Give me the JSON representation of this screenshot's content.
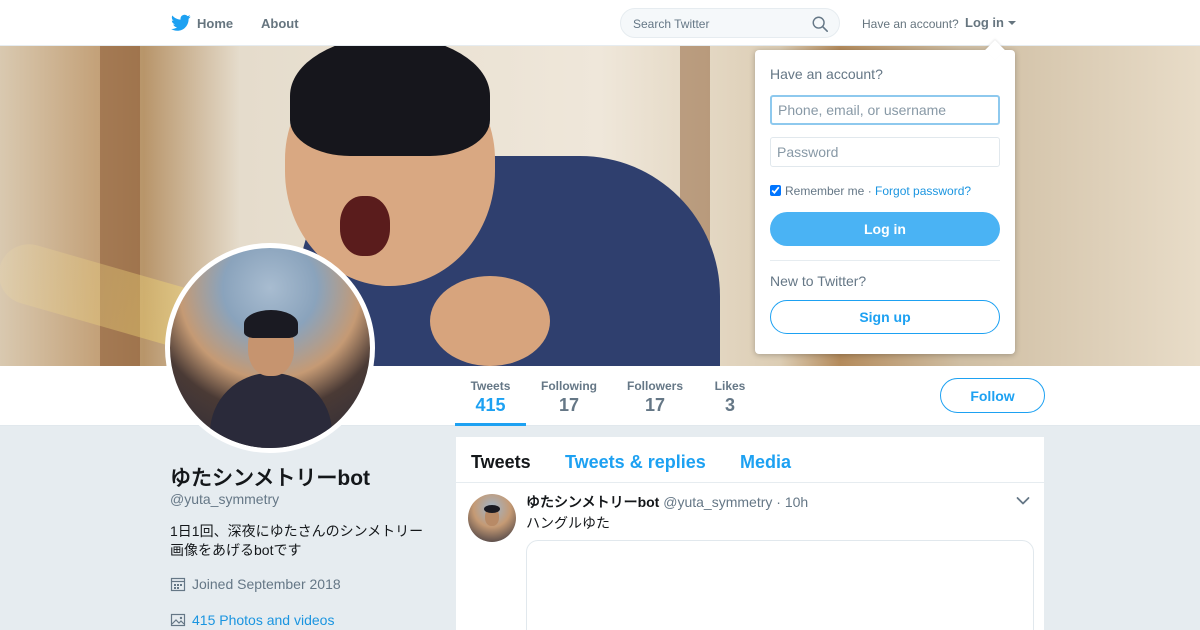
{
  "nav": {
    "logo_icon": "twitter-bird-icon",
    "home_label": "Home",
    "about_label": "About",
    "search_placeholder": "Search Twitter",
    "have_account": "Have an account?",
    "login_label": "Log in"
  },
  "profile": {
    "name": "ゆたシンメトリーbot",
    "handle": "@yuta_symmetry",
    "bio": "1日1回、深夜にゆたさんのシンメトリー画像をあげるbotです",
    "joined": "Joined September 2018",
    "photos": "415 Photos and videos"
  },
  "stats": {
    "tweets_label": "Tweets",
    "tweets_value": "415",
    "following_label": "Following",
    "following_value": "17",
    "followers_label": "Followers",
    "followers_value": "17",
    "likes_label": "Likes",
    "likes_value": "3"
  },
  "follow_label": "Follow",
  "timeline": {
    "tabs": [
      "Tweets",
      "Tweets & replies",
      "Media"
    ],
    "tweet": {
      "name": "ゆたシンメトリーbot",
      "meta": "@yuta_symmetry · 10h",
      "text": "ハングルゆた"
    }
  },
  "login_dropdown": {
    "title": "Have an account?",
    "username_placeholder": "Phone, email, or username",
    "password_placeholder": "Password",
    "remember": "Remember me",
    "separator": " · ",
    "forgot": "Forgot password?",
    "login_button": "Log in",
    "new_text": "New to Twitter?",
    "signup_button": "Sign up"
  },
  "colors": {
    "accent": "#1da1f2",
    "login_button": "#4ab3f4",
    "page_background": "#e6ecf0"
  }
}
